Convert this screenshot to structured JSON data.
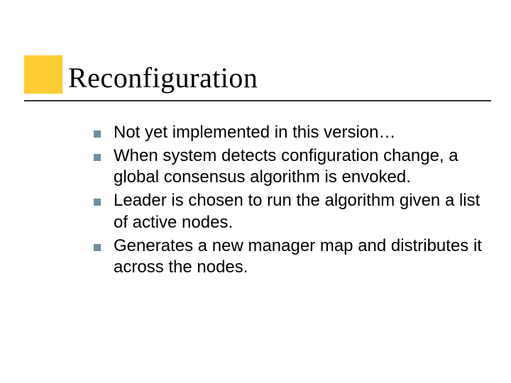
{
  "slide": {
    "title": "Reconfiguration",
    "bullets": [
      "Not yet implemented in this version…",
      "When system detects configuration change, a global consensus algorithm is envoked.",
      "Leader is chosen to run the algorithm given a list of active nodes.",
      "Generates a new manager map and distributes it across the nodes."
    ]
  }
}
